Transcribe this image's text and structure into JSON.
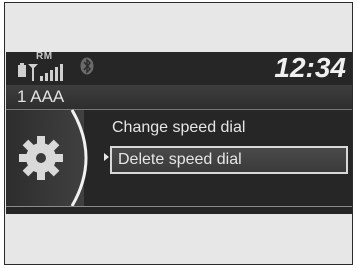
{
  "status": {
    "roaming_label": "RM",
    "time": "12:34"
  },
  "info": {
    "entry_label": "1 AAA"
  },
  "menu": {
    "items": [
      {
        "label": "Change speed dial",
        "selected": false
      },
      {
        "label": "Delete speed dial",
        "selected": true
      }
    ]
  },
  "icons": {
    "battery": "battery-icon",
    "signal": "signal-strength-icon",
    "bluetooth": "bluetooth-icon",
    "settings": "gear-icon"
  },
  "colors": {
    "screen_background": "#262626",
    "text": "#e6e6e6",
    "selection_border": "#d8d8d8"
  }
}
